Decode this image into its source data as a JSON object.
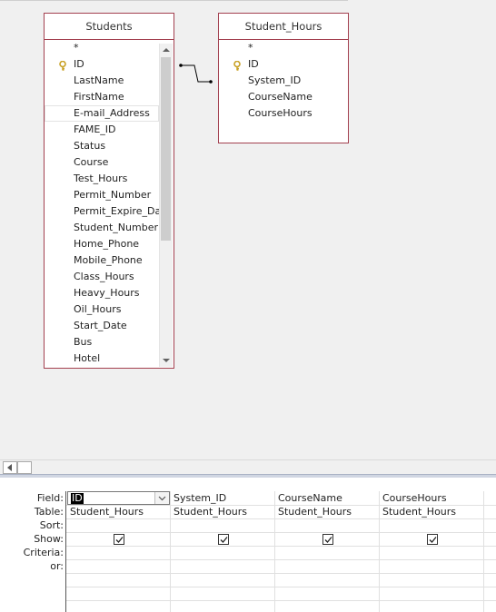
{
  "tables": [
    {
      "title": "Students",
      "fields": [
        {
          "label": "*",
          "key": false
        },
        {
          "label": "ID",
          "key": true
        },
        {
          "label": "LastName",
          "key": false
        },
        {
          "label": "FirstName",
          "key": false
        },
        {
          "label": "E-mail_Address",
          "key": false
        },
        {
          "label": "FAME_ID",
          "key": false
        },
        {
          "label": "Status",
          "key": false
        },
        {
          "label": "Course",
          "key": false
        },
        {
          "label": "Test_Hours",
          "key": false
        },
        {
          "label": "Permit_Number",
          "key": false
        },
        {
          "label": "Permit_Expire_Date",
          "key": false
        },
        {
          "label": "Student_Number",
          "key": false
        },
        {
          "label": "Home_Phone",
          "key": false
        },
        {
          "label": "Mobile_Phone",
          "key": false
        },
        {
          "label": "Class_Hours",
          "key": false
        },
        {
          "label": "Heavy_Hours",
          "key": false
        },
        {
          "label": "Oil_Hours",
          "key": false
        },
        {
          "label": "Start_Date",
          "key": false
        },
        {
          "label": "Bus",
          "key": false
        },
        {
          "label": "Hotel",
          "key": false
        }
      ]
    },
    {
      "title": "Student_Hours",
      "fields": [
        {
          "label": "*",
          "key": false
        },
        {
          "label": "ID",
          "key": true
        },
        {
          "label": "System_ID",
          "key": false
        },
        {
          "label": "CourseName",
          "key": false
        },
        {
          "label": "CourseHours",
          "key": false
        }
      ]
    }
  ],
  "grid": {
    "row_labels": [
      "Field:",
      "Table:",
      "Sort:",
      "Show:",
      "Criteria:",
      "or:"
    ],
    "columns": [
      {
        "field": "ID",
        "table": "Student_Hours",
        "show": true
      },
      {
        "field": "System_ID",
        "table": "Student_Hours",
        "show": true
      },
      {
        "field": "CourseName",
        "table": "Student_Hours",
        "show": true
      },
      {
        "field": "CourseHours",
        "table": "Student_Hours",
        "show": true
      }
    ]
  },
  "colors": {
    "table_border": "#a3404f",
    "key_icon": "#c9a227",
    "background": "#f0f0f0"
  }
}
